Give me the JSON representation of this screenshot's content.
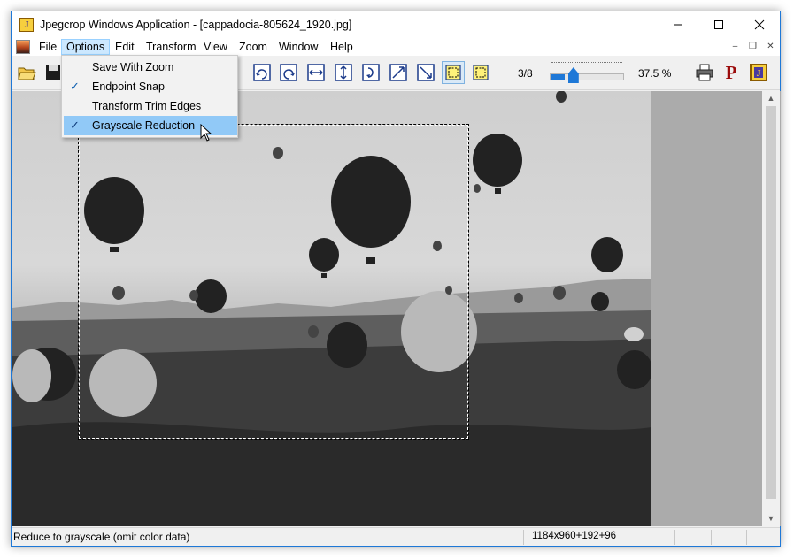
{
  "window": {
    "title": "Jpegcrop Windows Application - [cappadocia-805624_1920.jpg]",
    "controls": [
      "minimize",
      "maximize",
      "close"
    ],
    "accent_color": "#1e78d7"
  },
  "menubar": {
    "items": [
      "File",
      "Options",
      "Edit",
      "Transform",
      "View",
      "Zoom",
      "Window",
      "Help"
    ],
    "active": "Options"
  },
  "options_menu": {
    "items": [
      {
        "label": "Save With Zoom",
        "checked": false
      },
      {
        "label": "Endpoint Snap",
        "checked": true
      },
      {
        "label": "Transform Trim Edges",
        "checked": false
      },
      {
        "label": "Grayscale Reduction",
        "checked": true,
        "highlighted": true
      }
    ],
    "check_glyph": "✓"
  },
  "toolbar": {
    "page_indicator": "3/8",
    "zoom_value": "37.5 %",
    "zoom_fraction": 0.2,
    "icons": [
      "open-icon",
      "save-icon",
      "crop-icon",
      "rotate-left-icon",
      "rotate-right-icon",
      "flip-horizontal-icon",
      "flip-vertical-icon",
      "rotate-180-icon",
      "transpose-icon",
      "transverse-icon",
      "selection-snap-icon",
      "selection-icon",
      "print-icon",
      "progressive-icon",
      "about-icon"
    ],
    "progressive_label": "P"
  },
  "statusbar": {
    "message": "Reduce to grayscale (omit color data)",
    "dimensions": "1184x960+192+96"
  }
}
